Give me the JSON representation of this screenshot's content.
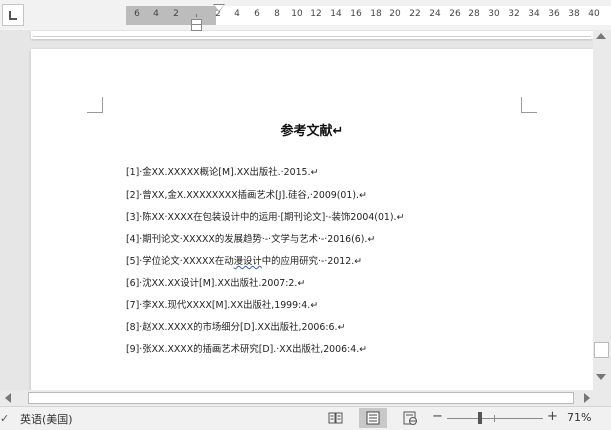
{
  "ruler": {
    "numbers": [
      "6",
      "4",
      "2",
      "",
      "2",
      "4",
      "6",
      "8",
      "10",
      "12",
      "14",
      "16",
      "18",
      "20",
      "22",
      "24",
      "26",
      "28",
      "30",
      "32",
      "34",
      "36",
      "38",
      "40"
    ]
  },
  "document": {
    "title": "参考文献↵",
    "references": [
      "[1]·金XX.XXXXX概论[M].XX出版社.·2015.↵",
      "[2]·曾XX,金X.XXXXXXXX插画艺术[J].硅谷,·2009(01).↵",
      "[3]·陈XX·XXXX在包装设计中的运用·[期刊论文]·-装饰2004(01).↵",
      "[4]·期刊论文·XXXXX的发展趋势·-·文学与艺术·-·2016(6).↵",
      "[5]·学位论文·XXXXX在动漫设计中的应用研究·-·2012.↵",
      "[6]·沈XX.XX设计[M].XX出版社.2007:2.↵",
      "[7]·李XX.现代XXXX[M].XX出版社,1999:4.↵",
      "[8]·赵XX.XXXX的市场细分[D].XX出版社,2006:6.↵",
      "[9]·张XX.XXXX的插画艺术研究[D].·XX出版社,2006:4.↵"
    ]
  },
  "statusbar": {
    "language": "英语(美国)",
    "zoom_minus": "−",
    "zoom_plus": "+",
    "zoom_level": "71%",
    "zoom_value_percent": 71
  },
  "icons": {
    "tab_selector": "tab-left-icon",
    "read_mode": "read-mode-icon",
    "print_layout": "print-layout-icon",
    "web_layout": "web-layout-icon",
    "scroll_up": "scroll-up-icon",
    "scroll_down": "scroll-down-icon",
    "scroll_left": "scroll-left-icon",
    "scroll_right": "scroll-right-icon"
  },
  "colors": {
    "active_view_bg": "#c8c8c8",
    "spell_squiggle": "#2f5fbf"
  }
}
